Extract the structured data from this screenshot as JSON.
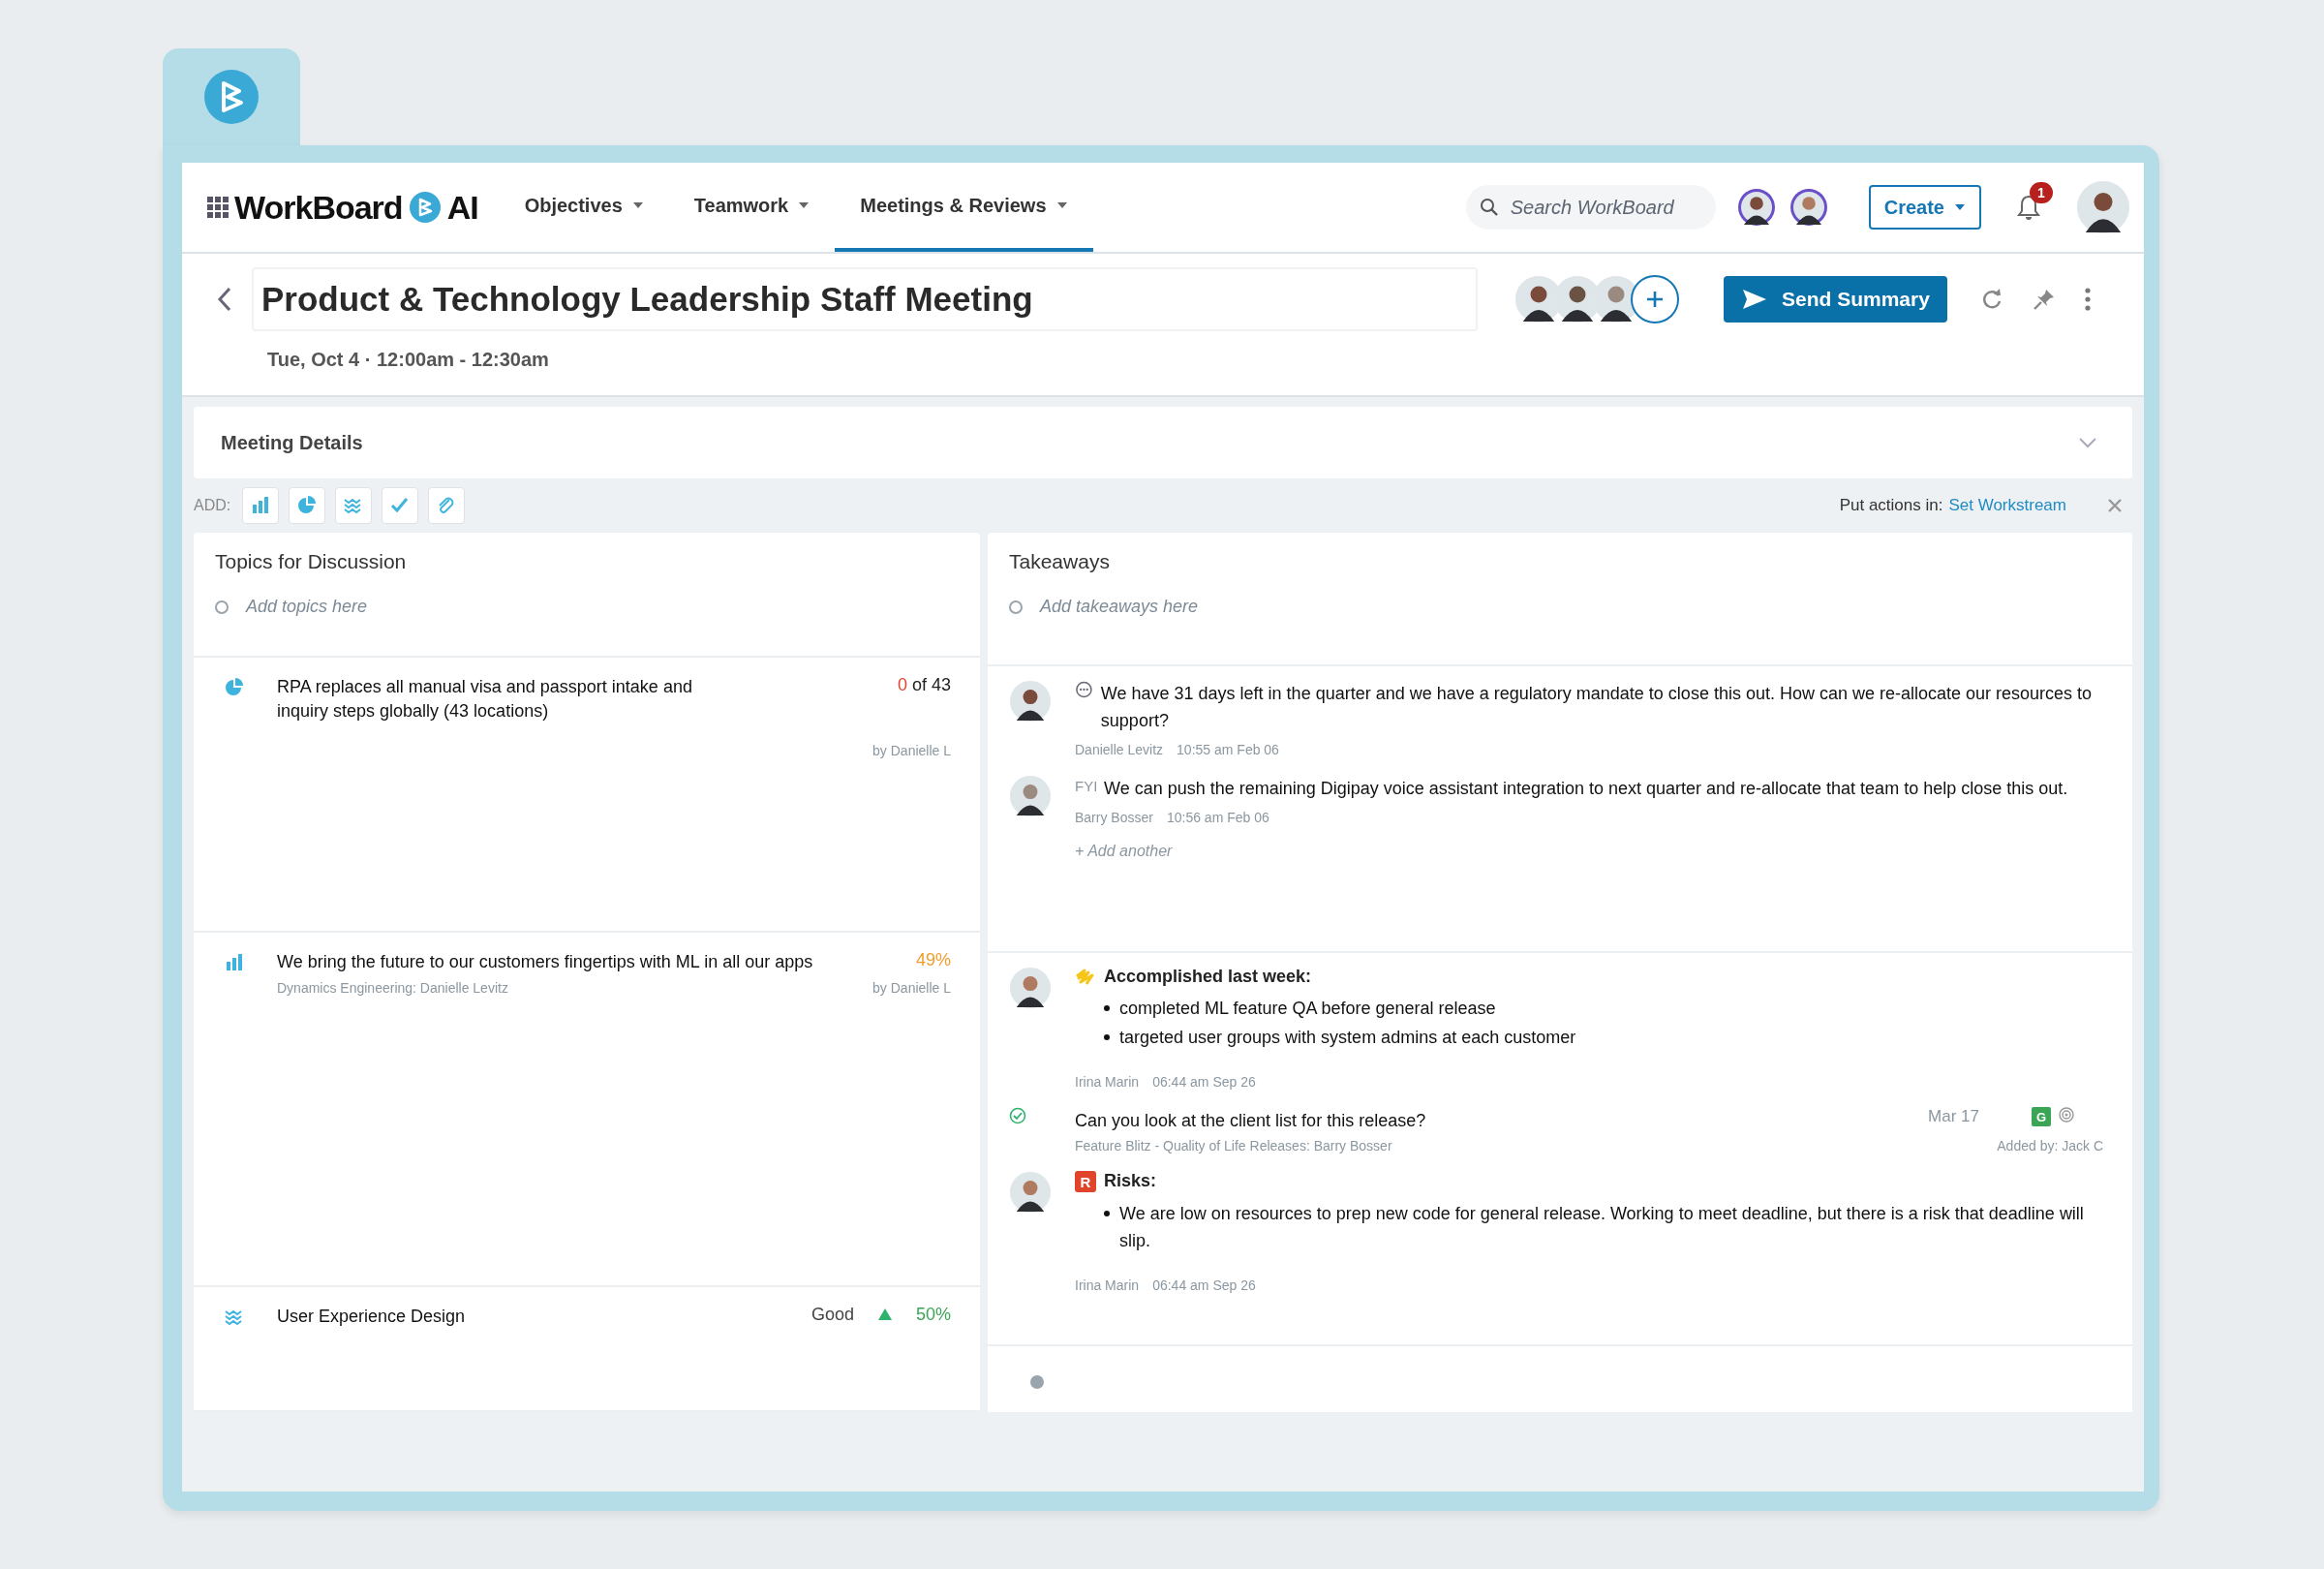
{
  "nav": {
    "brand": "WorkBoard",
    "brand_suffix": "AI",
    "menus": [
      {
        "label": "Objectives",
        "selected": false
      },
      {
        "label": "Teamwork",
        "selected": false
      },
      {
        "label": "Meetings & Reviews",
        "selected": true
      }
    ],
    "search": {
      "placeholder": "Search WorkBoard"
    },
    "create_button": "Create",
    "notification_count": "1"
  },
  "meeting": {
    "title": "Product & Technology Leadership Staff Meeting",
    "time": "Tue, Oct 4 · 12:00am - 12:30am",
    "send_button": "Send Summary"
  },
  "details": {
    "label": "Meeting Details",
    "expanded": false
  },
  "add_bar": {
    "label": "ADD:",
    "tools": [
      {
        "kind": "bar"
      },
      {
        "kind": "pie"
      },
      {
        "kind": "wave"
      },
      {
        "kind": "check"
      },
      {
        "kind": "clip"
      }
    ],
    "workstream_label": "Put actions in:",
    "workstream_link": "Set Workstream"
  },
  "topics": {
    "title": "Topics for Discussion",
    "placeholder": "Add topics here",
    "items": [
      {
        "kind": "pie",
        "text": "RPA replaces all manual visa and passport intake and inquiry steps globally (43 locations)",
        "value": "0",
        "total": "of 43",
        "color": "#e0452c",
        "by": "by Danielle L"
      },
      {
        "kind": "bar",
        "text": "We bring the future to our customers fingertips with ML in all our apps",
        "value": "49%",
        "color": "#f39c2b",
        "subtitle": "Dynamics Engineering: Danielle Levitz",
        "by": "by Danielle L"
      },
      {
        "kind": "wave",
        "text": "User Experience Design",
        "status": "Good",
        "improving": true,
        "value": "50%",
        "color": "#3aa655"
      }
    ]
  },
  "takeaways": {
    "title": "Takeaways",
    "placeholder": "Add takeaways here",
    "sections": [
      {
        "items": [
          {
            "kind": "question",
            "text": "We have 31 days left in the quarter and we have a regulatory mandate to close this out. How can we re-allocate our resources to support?",
            "author": "Danielle Levitz",
            "time": "10:55 am Feb 06"
          },
          {
            "kind": "comment",
            "prefix": "FYI",
            "text": "We can push the remaining Digipay voice assistant integration to next quarter and re-allocate that team to help close this out.",
            "author": "Barry Bosser",
            "time": "10:56 am Feb 06"
          },
          {
            "kind": "add",
            "text": "+ Add another"
          }
        ]
      },
      {
        "items": [
          {
            "kind": "note",
            "badge": {
              "kind": "pen"
            },
            "heading": "Accomplished last week:",
            "bullets": [
              "completed ML feature QA before general release",
              "targeted user groups with system admins at each customer"
            ],
            "author": "Irina Marin",
            "time": "06:44 am Sep 26"
          },
          {
            "kind": "action",
            "done": true,
            "text": "Can you look at the client list for this release?",
            "date": "Mar 17",
            "tag": "G",
            "subtitle": "Feature Blitz - Quality of Life Releases: Barry Bosser",
            "added_by": "Added by:  Jack C"
          },
          {
            "kind": "note",
            "badge": {
              "kind": "letter",
              "text": "R"
            },
            "heading": "Risks:",
            "bullets": [
              "We are low on resources to prep new code for general release. Working to meet deadline, but there is a risk that deadline will slip."
            ],
            "author": "Irina Marin",
            "time": "06:44 am Sep 26"
          }
        ]
      },
      {
        "items": [
          {
            "kind": "empty"
          }
        ]
      }
    ]
  }
}
